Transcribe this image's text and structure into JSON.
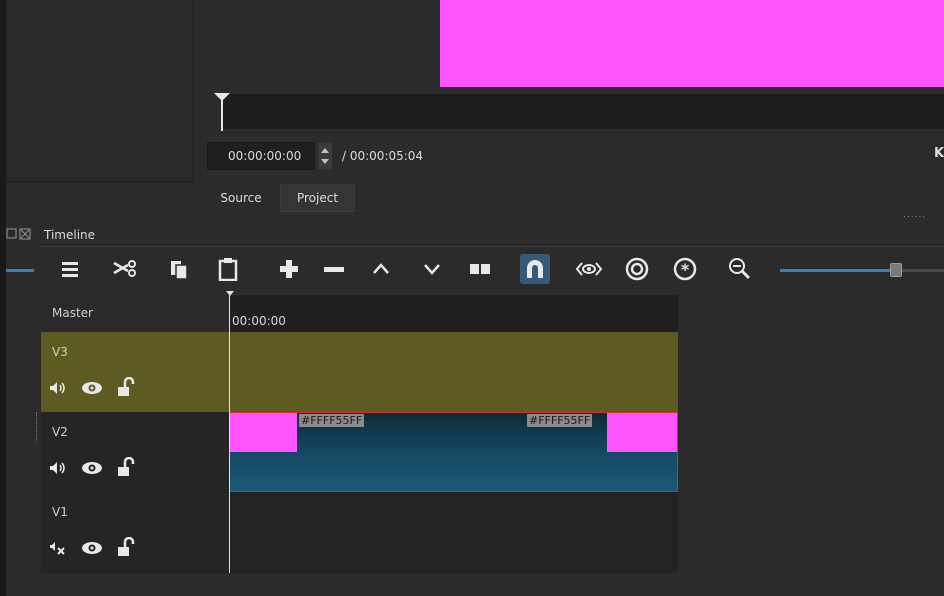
{
  "player": {
    "current_timecode": "00:00:00:00",
    "total_duration": "/ 00:00:05:04",
    "preview_color": "#ff55ff",
    "end_icon": "K"
  },
  "tabs": {
    "source_label": "Source",
    "project_label": "Project"
  },
  "panel_dots": "......",
  "timeline": {
    "title": "Timeline",
    "ruler_time": "00:00:00",
    "master_label": "Master",
    "tracks": [
      {
        "label": "V3",
        "color": "#5d5a22",
        "audio_icon": "speaker-on-icon",
        "visibility_icon": "eye-icon",
        "lock_icon": "unlock-icon"
      },
      {
        "label": "V2",
        "color": "#252525",
        "audio_icon": "speaker-on-icon",
        "visibility_icon": "eye-icon",
        "lock_icon": "unlock-icon"
      },
      {
        "label": "V1",
        "color": "#252525",
        "audio_icon": "speaker-muted-icon",
        "visibility_icon": "eye-icon",
        "lock_icon": "unlock-icon"
      }
    ],
    "clip": {
      "in_name": "#FFFF55FF",
      "out_name": "#FFFF55FF",
      "thumb_color": "#ff55ff",
      "border_color": "#d03030"
    },
    "toolbar": [
      "menu-icon",
      "cut-icon",
      "copy-icon",
      "paste-icon",
      "append-icon",
      "remove-icon",
      "lift-icon",
      "overwrite-icon",
      "split-icon",
      "snap-magnet-icon",
      "scrub-icon",
      "ripple-icon",
      "ripple-all-icon",
      "zoom-out-icon"
    ],
    "accent_color": "#3d7fb5"
  }
}
